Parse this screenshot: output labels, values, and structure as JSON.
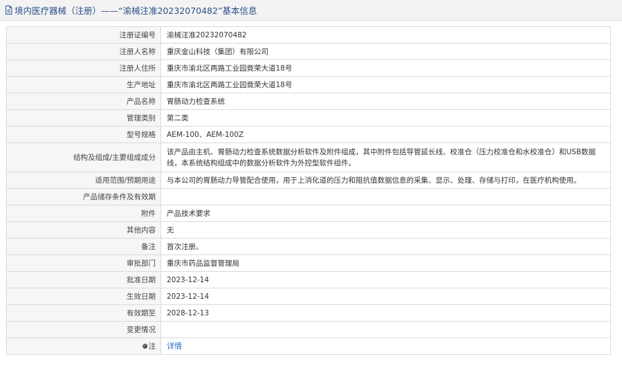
{
  "header": {
    "icon": "document-icon",
    "title": "境内医疗器械（注册）——“渝械注准20232070482”基本信息"
  },
  "rows": [
    {
      "label": "注册证编号",
      "value": "渝械注准20232070482"
    },
    {
      "label": "注册人名称",
      "value": "重庆金山科技（集团）有限公司"
    },
    {
      "label": "注册人住所",
      "value": "重庆市渝北区两路工业园竟荣大道18号"
    },
    {
      "label": "生产地址",
      "value": "重庆市渝北区两路工业园竟荣大道18号"
    },
    {
      "label": "产品名称",
      "value": "胃肠动力检查系统"
    },
    {
      "label": "管理类别",
      "value": "第二类"
    },
    {
      "label": "型号规格",
      "value": "AEM-100、AEM-100Z"
    },
    {
      "label": "结构及组成/主要组成成分",
      "value": "该产品由主机、胃肠动力检查系统数据分析软件及附件组成，其中附件包括导管延长线、校准仓（压力校准仓和水校准仓）和USB数据线，本系统结构组成中的数据分析软件为外控型软件组件。"
    },
    {
      "label": "适用范围/预期用途",
      "value": "与本公司的胃肠动力导管配合使用，用于上消化道的压力和阻抗值数据信息的采集、显示、处理、存储与打印，在医疗机构使用。"
    },
    {
      "label": "产品储存条件及有效期",
      "value": ""
    },
    {
      "label": "附件",
      "value": "产品技术要求"
    },
    {
      "label": "其他内容",
      "value": "无"
    },
    {
      "label": "备注",
      "value": "首次注册。"
    },
    {
      "label": "审批部门",
      "value": "重庆市药品监督管理局"
    },
    {
      "label": "批准日期",
      "value": "2023-12-14"
    },
    {
      "label": "生效日期",
      "value": "2023-12-14"
    },
    {
      "label": "有效期至",
      "value": "2028-12-13"
    },
    {
      "label": "变更情况",
      "value": ""
    }
  ],
  "note": {
    "label": "注",
    "icon": "bullet-icon",
    "link_text": "详情"
  }
}
